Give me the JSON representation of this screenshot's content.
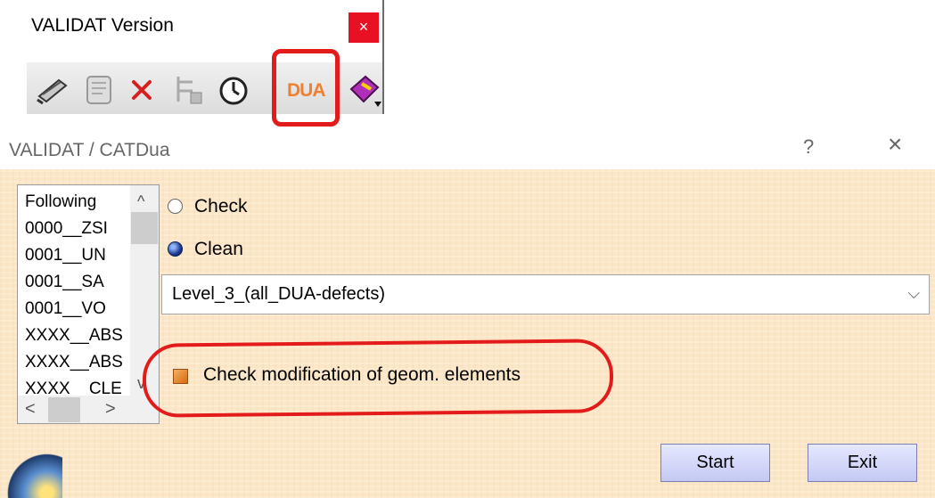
{
  "toolbar": {
    "title": "VALIDAT Version",
    "close_glyph": "×",
    "buttons": [
      {
        "icon": "pen-icon"
      },
      {
        "icon": "scroll-icon"
      },
      {
        "icon": "delete-x-icon"
      },
      {
        "icon": "tree-tool-icon"
      },
      {
        "icon": "clock-icon"
      },
      {
        "icon": "dua-icon",
        "text": "DUA"
      },
      {
        "icon": "help-book-icon"
      }
    ]
  },
  "dialog": {
    "title": "VALIDAT / CATDua",
    "help_glyph": "?",
    "close_glyph": "×",
    "list": {
      "items": [
        "Following",
        "0000__ZSI",
        "0001__UN",
        "0001__SA",
        "0001__VO",
        "XXXX__ABS",
        "XXXX__ABS",
        "XXXX__CLE"
      ],
      "scroll_up": "^",
      "scroll_down": "v",
      "scroll_left": "<",
      "scroll_right": ">"
    },
    "radios": {
      "check_label": "Check",
      "clean_label": "Clean",
      "selected": "Clean"
    },
    "level_select": {
      "value": "Level_3_(all_DUA-defects)",
      "arrow": "⌵"
    },
    "modification_checkbox": {
      "label": "Check modification of geom. elements",
      "checked": true
    },
    "buttons": {
      "start": "Start",
      "exit": "Exit"
    }
  },
  "colors": {
    "dialog_background": "#fbe7c7",
    "highlight": "#e41b1b",
    "button": "#c8cdf5",
    "dua_text": "#f08030"
  }
}
